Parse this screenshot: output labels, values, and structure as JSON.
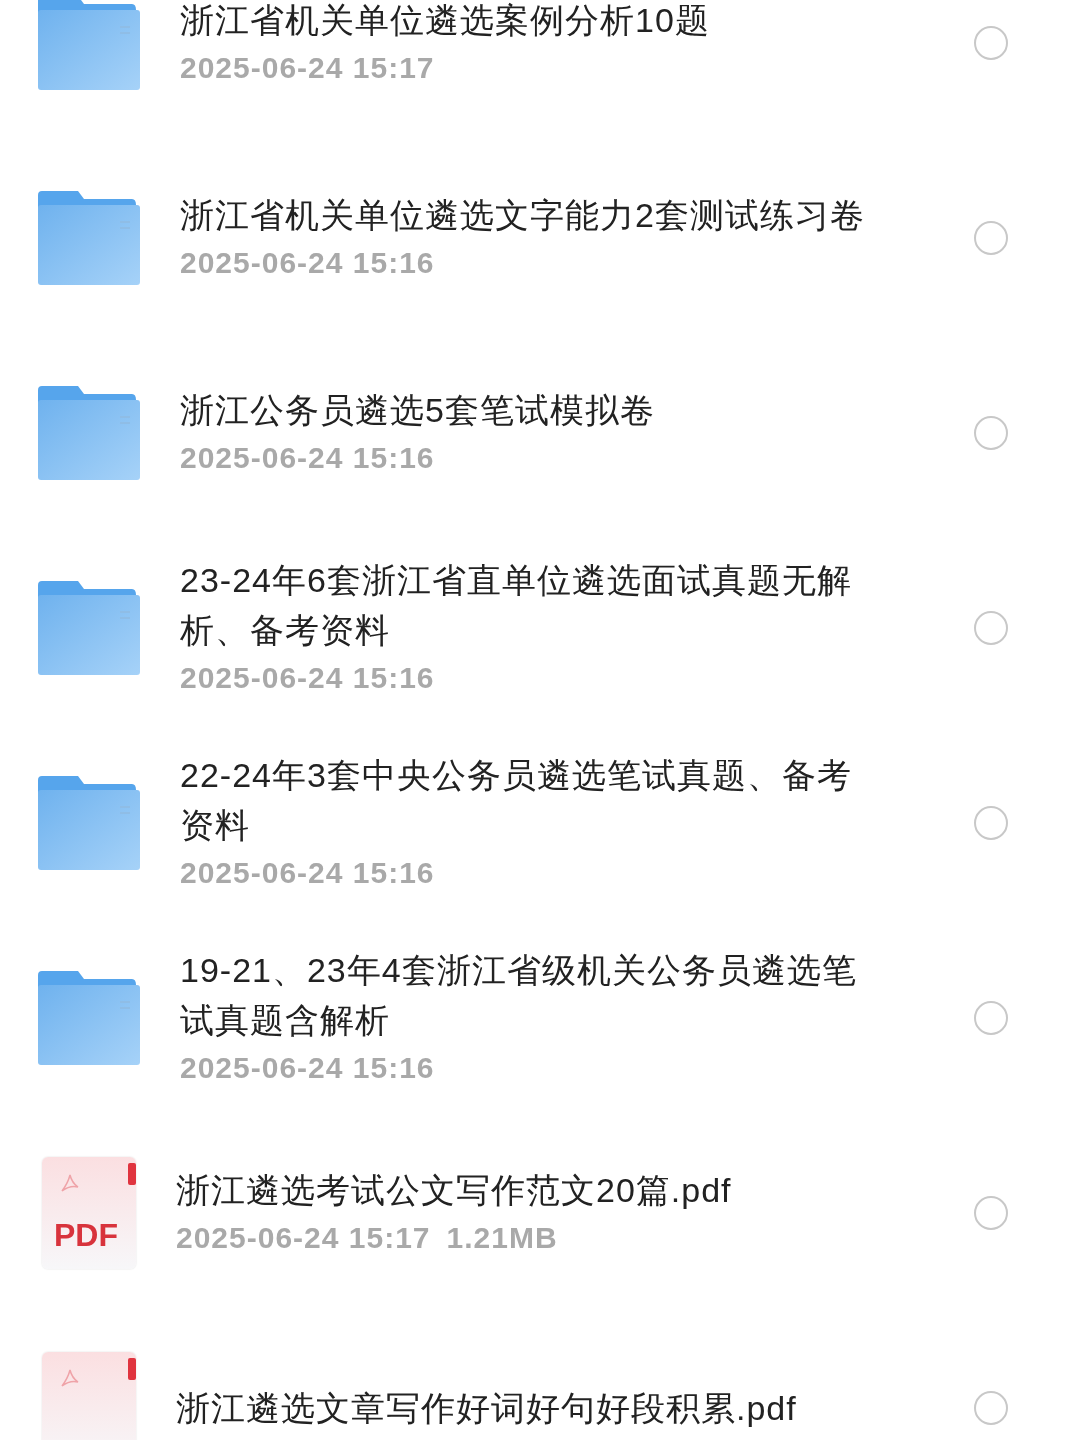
{
  "files": [
    {
      "kind": "folder",
      "name": "浙江省机关单位遴选案例分析10题",
      "date": "2025-06-24 15:17",
      "selected": false
    },
    {
      "kind": "folder",
      "name": "浙江省机关单位遴选文字能力2套测试练习卷",
      "date": "2025-06-24 15:16",
      "selected": false
    },
    {
      "kind": "folder",
      "name": "浙江公务员遴选5套笔试模拟卷",
      "date": "2025-06-24 15:16",
      "selected": false
    },
    {
      "kind": "folder",
      "name": "23-24年6套浙江省直单位遴选面试真题无解析、备考资料",
      "date": "2025-06-24 15:16",
      "selected": false
    },
    {
      "kind": "folder",
      "name": "22-24年3套中央公务员遴选笔试真题、备考资料",
      "date": "2025-06-24 15:16",
      "selected": false
    },
    {
      "kind": "folder",
      "name": "19-21、23年4套浙江省级机关公务员遴选笔试真题含解析",
      "date": "2025-06-24 15:16",
      "selected": false
    },
    {
      "kind": "pdf",
      "icon_label": "PDF",
      "name": "浙江遴选考试公文写作范文20篇.pdf",
      "date": "2025-06-24 15:17",
      "size": "1.21MB",
      "selected": false
    },
    {
      "kind": "pdf",
      "name": "浙江遴选文章写作好词好句好段积累.pdf",
      "selected": false
    }
  ]
}
